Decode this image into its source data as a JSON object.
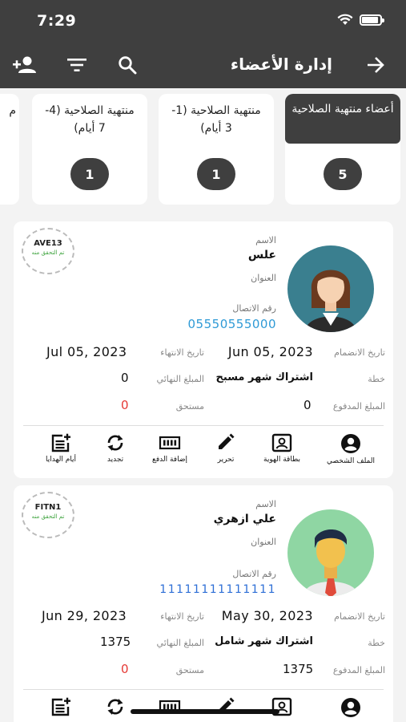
{
  "status": {
    "time": "7:29"
  },
  "header": {
    "title": "إدارة الأعضاء"
  },
  "filters": [
    {
      "label": "أعضاء منتهية الصلاحية",
      "count": "5"
    },
    {
      "label": "منتهية الصلاحية (1-3 أيام)",
      "count": "1"
    },
    {
      "label": "منتهية الصلاحية (4-7 أيام)",
      "count": "1"
    },
    {
      "label": "م",
      "count": ""
    }
  ],
  "labels": {
    "name": "الاسم",
    "address": "العنوان",
    "phone": "رقم الاتصال",
    "join_date": "تاريخ الانضمام",
    "end_date": "تاريخ الانتهاء",
    "plan": "خطة",
    "final_amount": "المبلغ النهائي",
    "paid": "المبلغ المدفوع",
    "due": "مستحق",
    "verified": "تم التحقق منه"
  },
  "actions": {
    "profile": "الملف الشخصي",
    "id_card": "بطاقة الهوية",
    "edit": "تحرير",
    "add_payment": "إضافة الدفع",
    "renew": "تجديد",
    "gift_days": "أيام الهدايا"
  },
  "members": [
    {
      "code": "AVE13",
      "name": "علس",
      "phone": "05550555000",
      "join_date": "Jun 05, 2023",
      "end_date": "Jul 05, 2023",
      "plan": "اشتراك شهر مسبح",
      "final_amount": "0",
      "paid": "0",
      "due": "0"
    },
    {
      "code": "FITN1",
      "name": "علي ازهري",
      "phone": "11111111111111",
      "join_date": "May 30, 2023",
      "end_date": "Jun 29, 2023",
      "plan": "اشتراك شهر شامل",
      "final_amount": "1375",
      "paid": "1375",
      "due": "0"
    }
  ],
  "colors": {
    "header": "#3f3f3f",
    "link": "#2e9ad6",
    "due": "#e53935",
    "verified": "#3aa23a"
  }
}
